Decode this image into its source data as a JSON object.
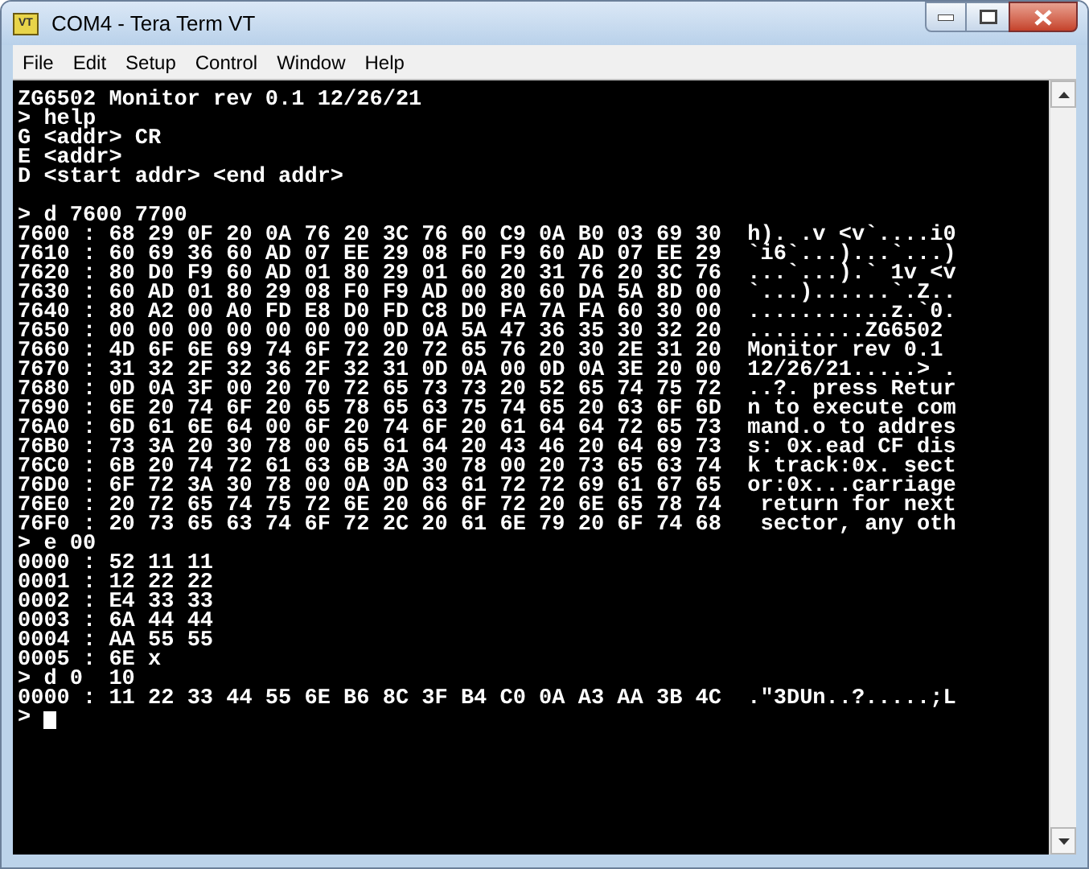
{
  "window": {
    "title": "COM4 - Tera Term VT",
    "app_icon_text": "VT"
  },
  "menu": [
    "File",
    "Edit",
    "Setup",
    "Control",
    "Window",
    "Help"
  ],
  "terminal": {
    "cursor": true,
    "lines": [
      {
        "kind": "text",
        "text": "ZG6502 Monitor rev 0.1 12/26/21"
      },
      {
        "kind": "text",
        "text": "> help"
      },
      {
        "kind": "text",
        "text": "G <addr> CR"
      },
      {
        "kind": "text",
        "text": "E <addr>"
      },
      {
        "kind": "text",
        "text": "D <start addr> <end addr>"
      },
      {
        "kind": "blank"
      },
      {
        "kind": "text",
        "text": "> d 7600 7700"
      },
      {
        "kind": "text",
        "text": "7600 : 68 29 0F 20 0A 76 20 3C 76 60 C9 0A B0 03 69 30  h). .v <v`....i0"
      },
      {
        "kind": "text",
        "text": "7610 : 60 69 36 60 AD 07 EE 29 08 F0 F9 60 AD 07 EE 29  `i6`...)...`...)"
      },
      {
        "kind": "text",
        "text": "7620 : 80 D0 F9 60 AD 01 80 29 01 60 20 31 76 20 3C 76  ...`...).` 1v <v"
      },
      {
        "kind": "text",
        "text": "7630 : 60 AD 01 80 29 08 F0 F9 AD 00 80 60 DA 5A 8D 00  `...)......`.Z.."
      },
      {
        "kind": "text",
        "text": "7640 : 80 A2 00 A0 FD E8 D0 FD C8 D0 FA 7A FA 60 30 00  ...........z.`0."
      },
      {
        "kind": "text",
        "text": "7650 : 00 00 00 00 00 00 00 0D 0A 5A 47 36 35 30 32 20  .........ZG6502"
      },
      {
        "kind": "text",
        "text": "7660 : 4D 6F 6E 69 74 6F 72 20 72 65 76 20 30 2E 31 20  Monitor rev 0.1"
      },
      {
        "kind": "text",
        "text": "7670 : 31 32 2F 32 36 2F 32 31 0D 0A 00 0D 0A 3E 20 00  12/26/21.....> ."
      },
      {
        "kind": "text",
        "text": "7680 : 0D 0A 3F 00 20 70 72 65 73 73 20 52 65 74 75 72  ..?. press Retur"
      },
      {
        "kind": "text",
        "text": "7690 : 6E 20 74 6F 20 65 78 65 63 75 74 65 20 63 6F 6D  n to execute com"
      },
      {
        "kind": "text",
        "text": "76A0 : 6D 61 6E 64 00 6F 20 74 6F 20 61 64 64 72 65 73  mand.o to addres"
      },
      {
        "kind": "text",
        "text": "76B0 : 73 3A 20 30 78 00 65 61 64 20 43 46 20 64 69 73  s: 0x.ead CF dis"
      },
      {
        "kind": "text",
        "text": "76C0 : 6B 20 74 72 61 63 6B 3A 30 78 00 20 73 65 63 74  k track:0x. sect"
      },
      {
        "kind": "text",
        "text": "76D0 : 6F 72 3A 30 78 00 0A 0D 63 61 72 72 69 61 67 65  or:0x...carriage"
      },
      {
        "kind": "text",
        "text": "76E0 : 20 72 65 74 75 72 6E 20 66 6F 72 20 6E 65 78 74   return for next"
      },
      {
        "kind": "text",
        "text": "76F0 : 20 73 65 63 74 6F 72 2C 20 61 6E 79 20 6F 74 68   sector, any oth"
      },
      {
        "kind": "text",
        "text": "> e 00"
      },
      {
        "kind": "text",
        "text": "0000 : 52 11 11"
      },
      {
        "kind": "text",
        "text": "0001 : 12 22 22"
      },
      {
        "kind": "text",
        "text": "0002 : E4 33 33"
      },
      {
        "kind": "text",
        "text": "0003 : 6A 44 44"
      },
      {
        "kind": "text",
        "text": "0004 : AA 55 55"
      },
      {
        "kind": "text",
        "text": "0005 : 6E x"
      },
      {
        "kind": "text",
        "text": "> d 0  10"
      },
      {
        "kind": "text",
        "text": "0000 : 11 22 33 44 55 6E B6 8C 3F B4 C0 0A A3 AA 3B 4C  .\"3DUn..?.....;L"
      },
      {
        "kind": "prompt",
        "text": ">"
      }
    ]
  }
}
